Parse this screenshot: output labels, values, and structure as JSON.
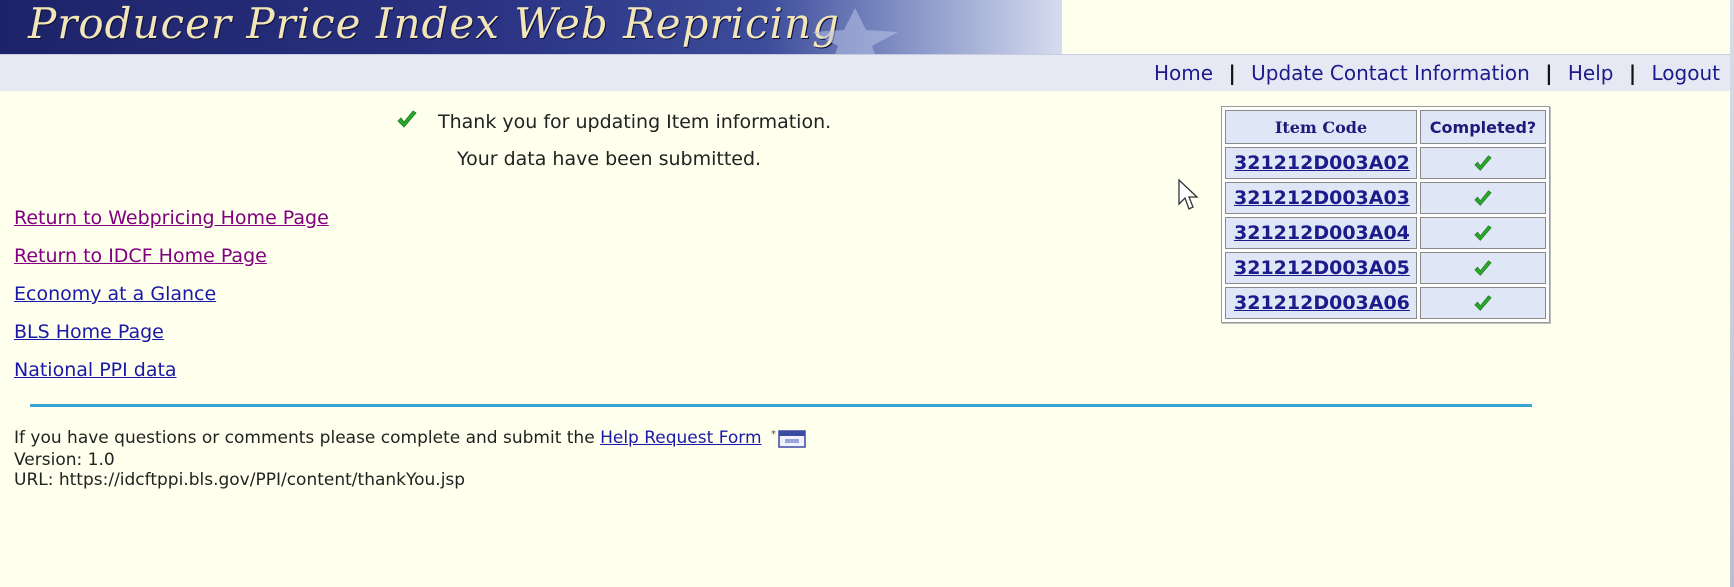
{
  "banner": {
    "title": "Producer Price Index Web Repricing"
  },
  "nav": {
    "home": "Home",
    "update_contact": "Update Contact Information",
    "help": "Help",
    "logout": "Logout",
    "separator": "|"
  },
  "message": {
    "line1": "Thank you for updating Item information.",
    "line2": "Your data have been submitted.",
    "icon": "check-icon"
  },
  "side_links": [
    {
      "label": "Return to Webpricing Home Page",
      "visited": true
    },
    {
      "label": "Return to IDCF Home Page",
      "visited": true
    },
    {
      "label": "Economy at a Glance",
      "visited": false
    },
    {
      "label": "BLS Home Page",
      "visited": false
    },
    {
      "label": "National PPI data",
      "visited": false
    }
  ],
  "item_table": {
    "headers": {
      "code": "Item Code",
      "completed": "Completed?"
    },
    "rows": [
      {
        "code": "321212D003A02",
        "completed": true
      },
      {
        "code": "321212D003A03",
        "completed": true
      },
      {
        "code": "321212D003A04",
        "completed": true
      },
      {
        "code": "321212D003A05",
        "completed": true
      },
      {
        "code": "321212D003A06",
        "completed": true
      }
    ]
  },
  "footer": {
    "help_text": "If you have questions or comments please complete and submit the",
    "help_link": "Help Request Form",
    "version": "Version: 1.0",
    "url": "URL: https://idcftppi.bls.gov/PPI/content/thankYou.jsp"
  },
  "colors": {
    "page_background": "#ffffee",
    "navbar_background": "#e6e9f4",
    "link": "#1a1aa8",
    "visited_link": "#800080",
    "check_green": "#2aa82a",
    "divider": "#3aa3d8"
  }
}
